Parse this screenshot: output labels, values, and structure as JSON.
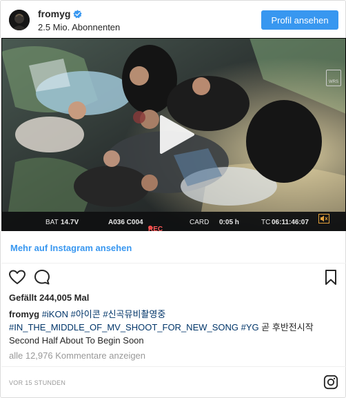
{
  "header": {
    "username": "fromyg",
    "subscribers": "2.5 Mio. Abonnenten",
    "profile_button": "Profil ansehen"
  },
  "media": {
    "hud": {
      "bat": "BAT",
      "bat_value": "14.7V",
      "clip": "A036 C004",
      "rec": "REC",
      "card": "CARD",
      "duration": "0:05 h",
      "tc": "TC",
      "timecode": "06:11:46:07",
      "wrs": "WRS"
    }
  },
  "more_link": "Mehr auf Instagram ansehen",
  "likes": "Gefällt 244,005 Mal",
  "caption": {
    "user": "fromyg",
    "tags_line1": [
      "#iKON",
      "#아이콘",
      "#신곡뮤비촬영중"
    ],
    "tags_line2": [
      "#IN_THE_MIDDLE_OF_MV_SHOOT_FOR_NEW_SONG",
      "#YG"
    ],
    "korean_text": "곧 후반전시작",
    "english_text": "Second Half About To Begin Soon"
  },
  "comments": "alle 12,976 Kommentare anzeigen",
  "timestamp": "VOR 15 STUNDEN",
  "icons": {
    "like": "heart-outline-icon",
    "comment": "comment-bubble-icon",
    "save": "bookmark-outline-icon",
    "brand": "instagram-logo-icon",
    "verified": "verified-badge-icon",
    "play": "play-icon"
  },
  "colors": {
    "accent": "#3897f0",
    "hashtag": "#003569",
    "muted": "#999999",
    "text": "#262626"
  }
}
